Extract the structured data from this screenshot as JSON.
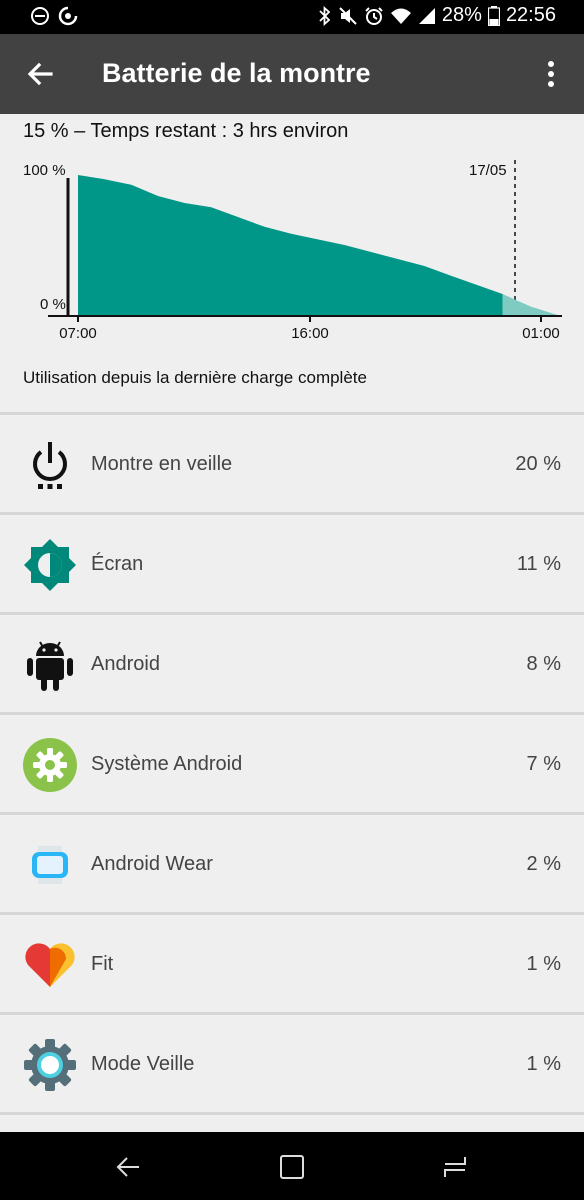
{
  "status_bar": {
    "icons_left": [
      "do-not-disturb-icon",
      "data-saver-icon"
    ],
    "icons_right": [
      "bluetooth-icon",
      "mute-icon",
      "alarm-icon",
      "wifi-icon",
      "signal-icon"
    ],
    "battery": "28%",
    "time": "22:56"
  },
  "app_bar": {
    "title": "Batterie de la montre",
    "back_icon": "back-arrow-icon",
    "more_icon": "more-vert-icon"
  },
  "summary": "15 % – Temps restant : 3 hrs environ",
  "chart_data": {
    "type": "area",
    "y_ticks": [
      "100 %",
      "0 %"
    ],
    "x_ticks": [
      "07:00",
      "16:00",
      "01:00"
    ],
    "marker_label": "17/05",
    "series": [
      {
        "x": [
          "07:00",
          "08:00",
          "09:00",
          "10:00",
          "11:00",
          "12:00",
          "13:00",
          "14:00",
          "15:00",
          "16:00",
          "17:00",
          "18:00",
          "19:00",
          "20:00",
          "21:00",
          "22:56"
        ],
        "y": [
          100,
          97,
          93,
          85,
          80,
          77,
          70,
          63,
          58,
          54,
          50,
          45,
          40,
          35,
          28,
          15
        ]
      },
      {
        "x": [
          "22:56",
          "00:00",
          "01:00"
        ],
        "y": [
          15,
          6,
          0
        ]
      }
    ],
    "colors": {
      "measured": "#009688",
      "projected": "#7fcbc2"
    },
    "ylim": [
      0,
      100
    ]
  },
  "section_header": "Utilisation depuis la dernière charge complète",
  "usage": [
    {
      "label": "Montre en veille",
      "pct": "20 %",
      "icon": "power-standby-icon"
    },
    {
      "label": "Écran",
      "pct": "11 %",
      "icon": "brightness-icon"
    },
    {
      "label": "Android",
      "pct": "8 %",
      "icon": "android-icon"
    },
    {
      "label": "Système Android",
      "pct": "7 %",
      "icon": "android-system-gear-icon"
    },
    {
      "label": "Android Wear",
      "pct": "2 %",
      "icon": "android-wear-icon"
    },
    {
      "label": "Fit",
      "pct": "1 %",
      "icon": "fit-heart-icon"
    },
    {
      "label": "Mode Veille",
      "pct": "1 %",
      "icon": "mode-veille-icon"
    }
  ],
  "nav_bar": {
    "icons": [
      "nav-back-icon",
      "nav-home-icon",
      "nav-recents-icon"
    ]
  }
}
